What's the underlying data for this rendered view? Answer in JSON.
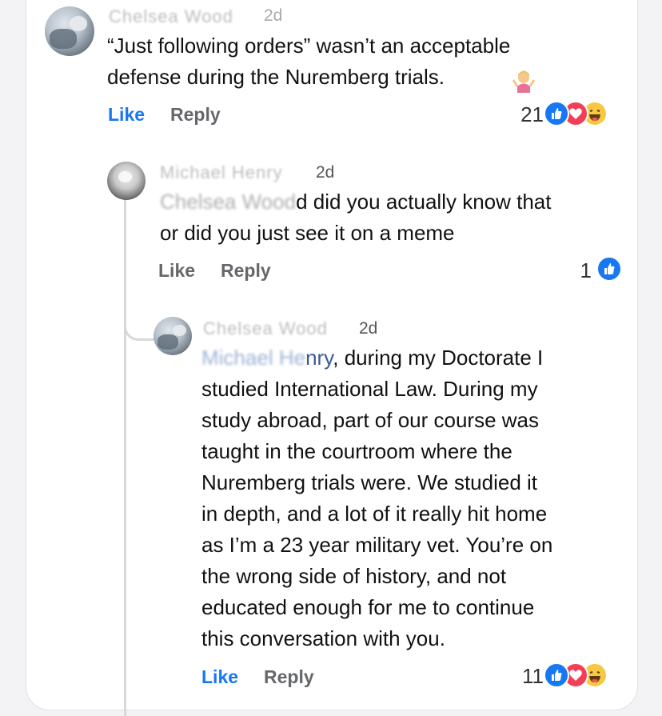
{
  "comments": [
    {
      "author_blurred": "Chelsea Wood",
      "time": "2d",
      "text_line1": "“Just following orders” wasn’t an acceptable",
      "text_line2": "defense during the Nuremberg trials.",
      "emoji_icon": "person-shrugging-emoji",
      "like_label": "Like",
      "reply_label": "Reply",
      "reaction_count": "21",
      "reaction_icons": [
        "like-icon",
        "love-icon",
        "haha-icon"
      ]
    },
    {
      "author_blurred": "Michael Henry",
      "time": "2d",
      "mention_blurred": "Chelsea Wood",
      "text_line1_rest": "d did you actually know that",
      "text_line2": "or did you just see it on a meme",
      "like_label": "Like",
      "reply_label": "Reply",
      "reaction_count": "1",
      "reaction_icons": [
        "like-icon"
      ]
    },
    {
      "author_blurred": "Chelsea Wood",
      "time": "2d",
      "mention_blurred": "Michael He",
      "mention_visible": "nry",
      "lines": [
        ", during my Doctorate I",
        "studied International Law.  During my",
        "study abroad, part of our course was",
        "taught in the courtroom where the",
        "Nuremberg trials were.  We studied it",
        "in depth, and a lot of it really hit home",
        "as I’m a 23 year military vet.  You’re on",
        "the wrong side of history, and not",
        "educated enough for me to continue",
        "this conversation with you."
      ],
      "like_label": "Like",
      "reply_label": "Reply",
      "reaction_count": "11",
      "reaction_icons": [
        "like-icon",
        "love-icon",
        "haha-icon"
      ]
    }
  ],
  "colors": {
    "like_blue": "#1877f2",
    "love_red": "#f33e58",
    "haha_yellow": "#f7c843",
    "action_gray": "#65676b"
  }
}
